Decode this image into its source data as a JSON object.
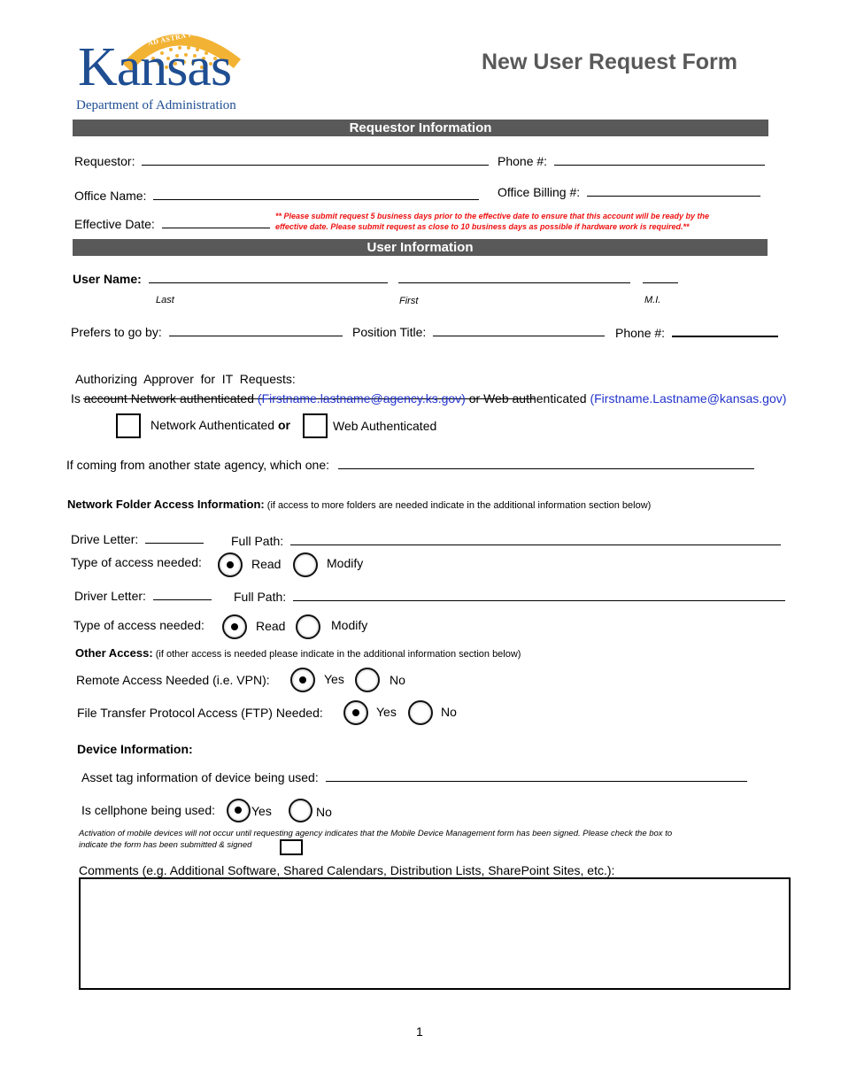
{
  "header": {
    "logo": {
      "motto": "AD ASTRA PER ASPERA",
      "state": "Kansas",
      "department": "Department of Administration",
      "motto_color": "#f2b233",
      "brand_color": "#1f4e92"
    },
    "title": "New User Request Form"
  },
  "requestor_section": {
    "heading": "Requestor Information",
    "requestor_label": "Requestor:",
    "phone_label": "Phone #:",
    "office_name_label": "Office Name:",
    "office_billing_label": "Office Billing #:",
    "effective_date_label": "Effective Date:",
    "notice_line1": "** Please submit request 5 business days prior to the effective date to ensure that this account will be ready by the",
    "notice_line2": "effective date. Please submit request as close to 10 business days as possible if hardware work is required.**",
    "notice_color": "#e11111"
  },
  "user_section": {
    "heading": "User Information",
    "user_name_label": "User Name:",
    "last_caption": "Last",
    "first_caption": "First",
    "mi_caption": "M.I.",
    "prefers_label": "Prefers to go by:",
    "position_label": "Position Title:",
    "phone_label": "Phone #:",
    "approver_label": "Authorizing  Approver  for  IT  Requests:",
    "auth_question_prefix": "Is account Network authenticated ",
    "auth_network_example": "(Firstname.lastname@agency.ks.gov)",
    "auth_question_mid": " or Web authenticated ",
    "auth_web_example": "(Firstname.Lastname@kansas.gov)",
    "network_auth_label": "Network Authenticated ",
    "or_label": "or",
    "web_auth_label": "Web Authenticated",
    "network_auth_checked": false,
    "web_auth_checked": false,
    "agency_label": "If coming from another state agency, which one:"
  },
  "network_folder": {
    "heading": "Network Folder Access Information:",
    "note": " (if access to more folders are needed indicate in the additional information section below)",
    "entries": [
      {
        "drive_label": "Drive Letter:",
        "path_label": "Full Path:",
        "access_label": "Type of access needed:",
        "read_label": "Read",
        "modify_label": "Modify",
        "selected": "Read"
      },
      {
        "drive_label": "Driver Letter:",
        "path_label": "Full Path:",
        "access_label": "Type of access needed:",
        "read_label": "Read",
        "modify_label": "Modify",
        "selected": "Read"
      }
    ]
  },
  "other_access": {
    "heading": "Other Access:",
    "note": " (if other access is needed please indicate in the additional information section below)",
    "remote_label": "Remote Access Needed (i.e. VPN):",
    "ftp_label": "File Transfer Protocol Access (FTP) Needed:",
    "yes_label": "Yes",
    "no_label": "No",
    "remote_selected": "Yes",
    "ftp_selected": "Yes"
  },
  "device": {
    "heading": "Device Information:",
    "asset_label": "Asset tag information of device being used:",
    "cellphone_label": "Is cellphone being used:",
    "yes_label": "Yes",
    "no_label": "No",
    "cellphone_selected": "Yes",
    "mdm_note_line1": "Activation of mobile devices will not occur until requesting agency indicates that the Mobile Device Management form has been signed. Please check the box to",
    "mdm_note_line2": "indicate the form has been submitted & signed",
    "mdm_checked": false
  },
  "comments": {
    "label": "Comments (e.g. Additional Software, Shared Calendars, Distribution Lists, SharePoint Sites, etc.):",
    "value": ""
  },
  "footer": {
    "page_number": "1"
  }
}
